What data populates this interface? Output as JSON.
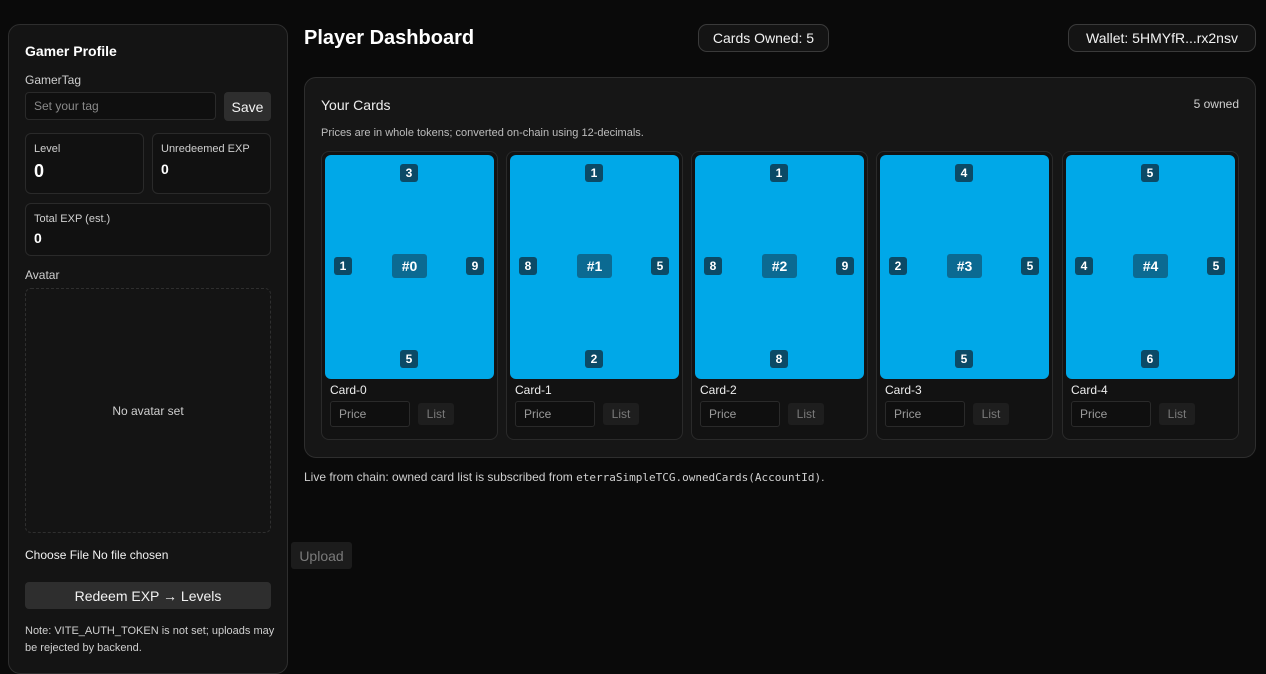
{
  "sidebar": {
    "title": "Gamer Profile",
    "gamertag_label": "GamerTag",
    "gamertag_placeholder": "Set your tag",
    "gamertag_value": "",
    "save_label": "Save",
    "level_label": "Level",
    "level_value": "0",
    "unredeemed_label": "Unredeemed EXP",
    "unredeemed_value": "0",
    "total_label": "Total EXP (est.)",
    "total_value": "0",
    "avatar_label": "Avatar",
    "avatar_empty": "No avatar set",
    "file_status": "Choose File No file chosen",
    "upload_label": "Upload",
    "redeem_label": "Redeem EXP → Levels",
    "note": "Note: VITE_AUTH_TOKEN is not set; uploads may be rejected by backend."
  },
  "header": {
    "title": "Player Dashboard",
    "cards_owned": "Cards Owned: 5",
    "wallet": "Wallet: 5HMYfR...rx2nsv"
  },
  "cards_panel": {
    "title": "Your Cards",
    "count": "5 owned",
    "note": "Prices are in whole tokens; converted on-chain using 12-decimals.",
    "price_placeholder": "Price",
    "list_label": "List",
    "card_color": "#00a8e8",
    "cards": [
      {
        "id": "#0",
        "name": "Card-0",
        "top": "3",
        "left": "1",
        "right": "9",
        "bottom": "5"
      },
      {
        "id": "#1",
        "name": "Card-1",
        "top": "1",
        "left": "8",
        "right": "5",
        "bottom": "2"
      },
      {
        "id": "#2",
        "name": "Card-2",
        "top": "1",
        "left": "8",
        "right": "9",
        "bottom": "8"
      },
      {
        "id": "#3",
        "name": "Card-3",
        "top": "4",
        "left": "2",
        "right": "5",
        "bottom": "5"
      },
      {
        "id": "#4",
        "name": "Card-4",
        "top": "5",
        "left": "4",
        "right": "5",
        "bottom": "6"
      }
    ]
  },
  "footer": {
    "text": "Live from chain: owned card list is subscribed from ",
    "code": "eterraSimpleTCG.ownedCards(AccountId)",
    "suffix": "."
  }
}
